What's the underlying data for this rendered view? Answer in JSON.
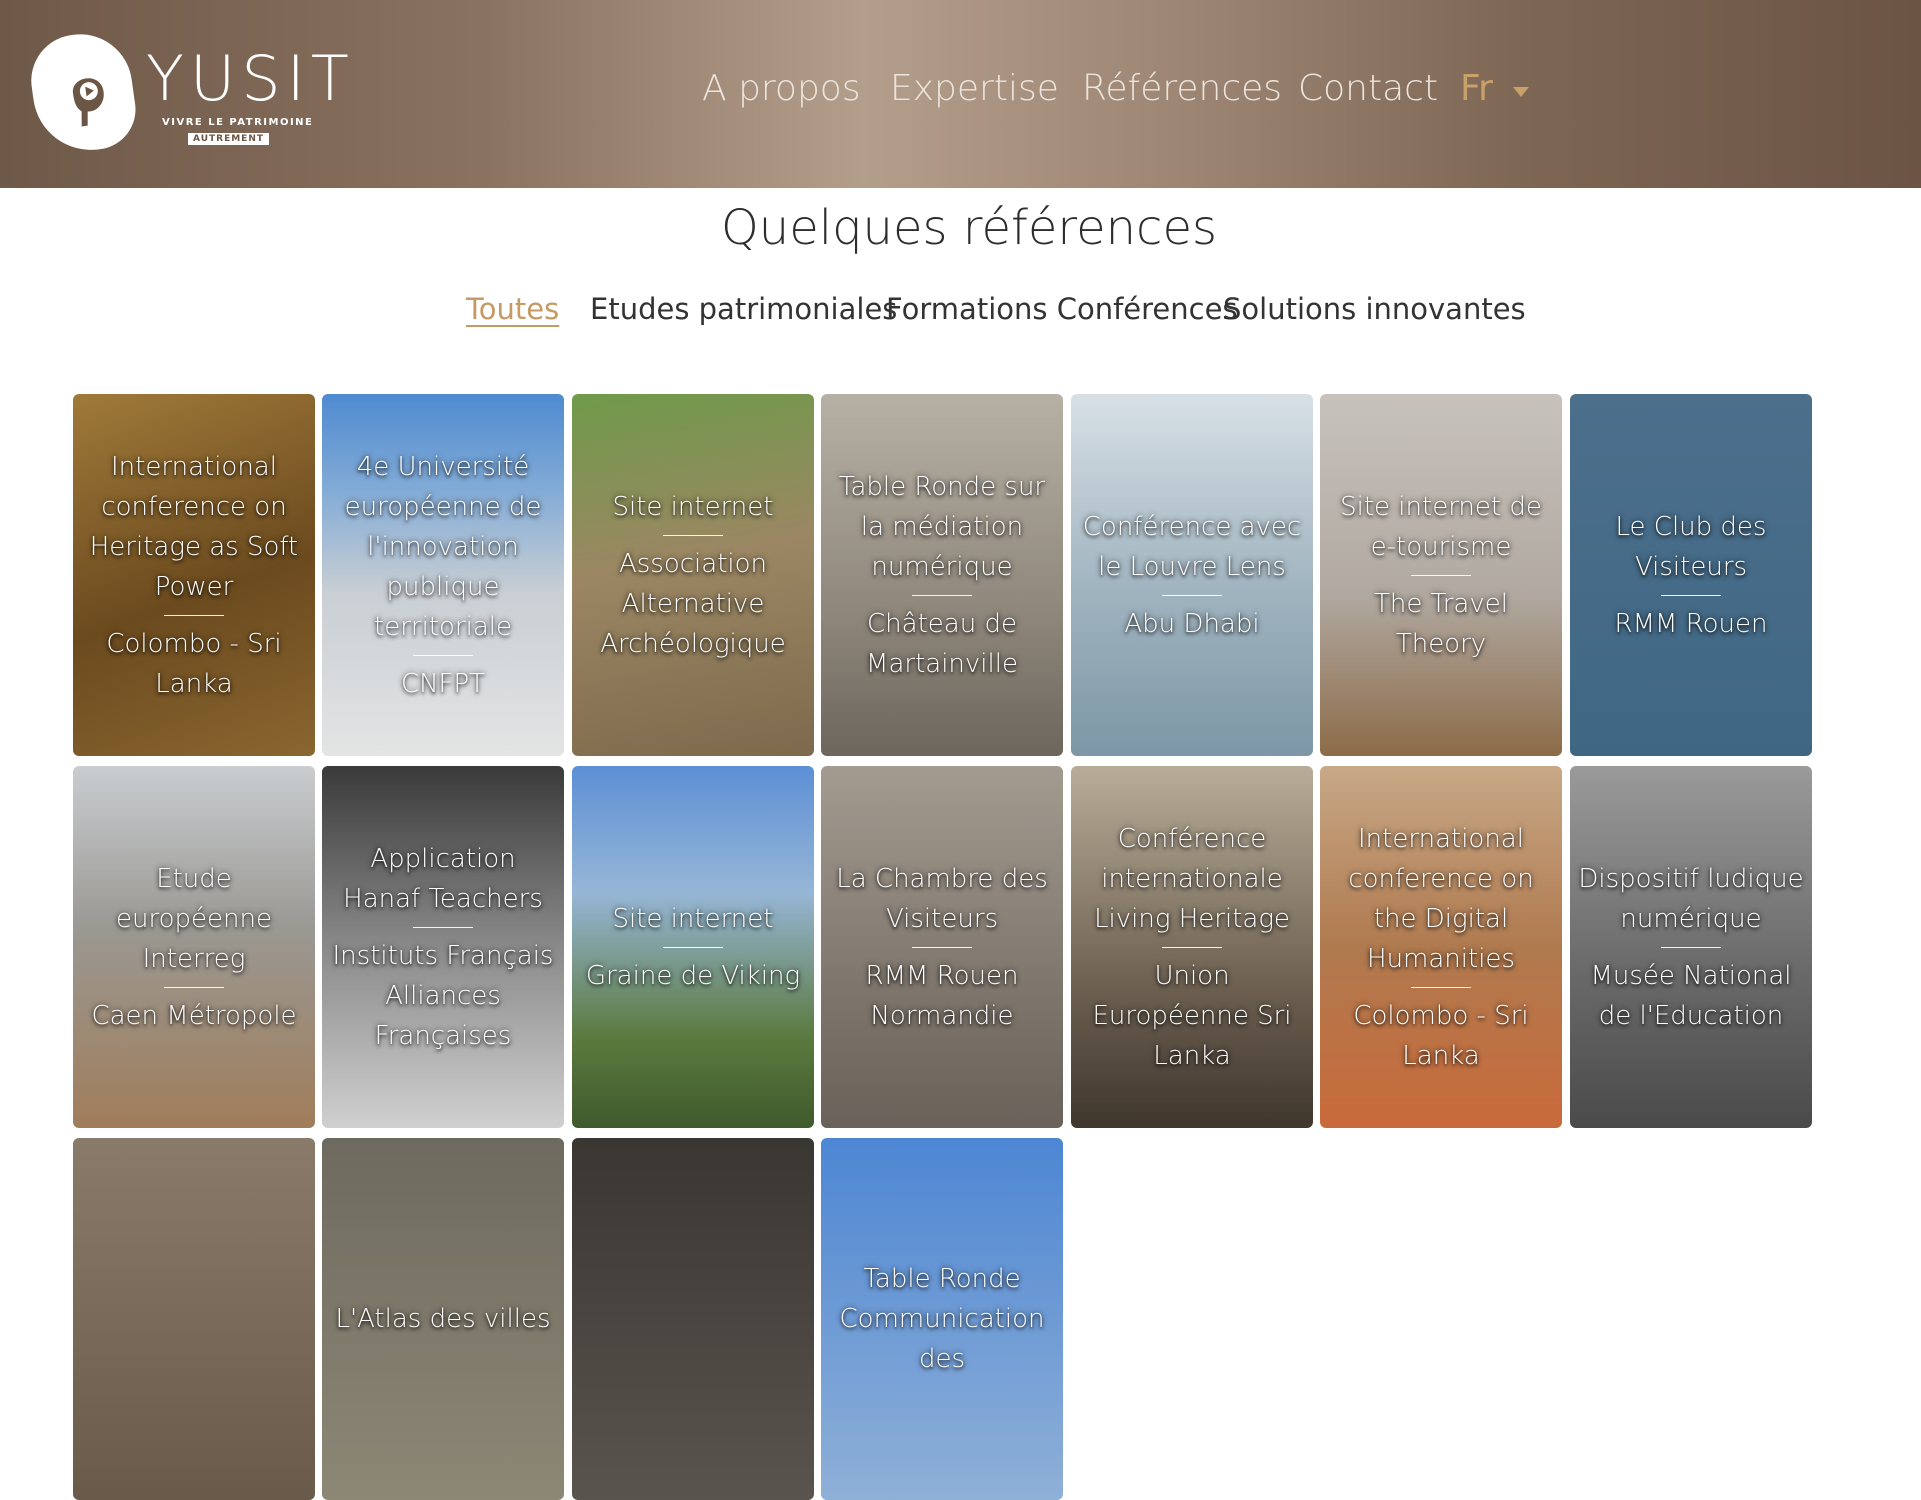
{
  "brand": {
    "name": "YUSIT",
    "tagline": "VIVRE LE PATRIMOINE",
    "tag": "AUTREMENT"
  },
  "nav": {
    "items": [
      "A propos",
      "Expertise",
      "Références",
      "Contact"
    ],
    "lang": "Fr"
  },
  "page": {
    "title": "Quelques références"
  },
  "filters": [
    "Toutes",
    "Etudes patrimoniales",
    "Formations Conférences",
    "Solutions innovantes"
  ],
  "cards": [
    {
      "title": "International conference on Heritage as Soft Power",
      "subtitle": "Colombo - Sri Lanka"
    },
    {
      "title": "4e Université européenne de l'innovation publique territoriale",
      "subtitle": "CNFPT"
    },
    {
      "title": "Site internet",
      "subtitle": "Association Alternative Archéologique"
    },
    {
      "title": "Table Ronde sur la médiation numérique",
      "subtitle": "Château de Martainville"
    },
    {
      "title": "Conférence avec le Louvre Lens",
      "subtitle": "Abu Dhabi"
    },
    {
      "title": "Site internet de e-tourisme",
      "subtitle": "The Travel Theory"
    },
    {
      "title": "Le Club des Visiteurs",
      "subtitle": "RMM Rouen"
    },
    {
      "title": "Etude européenne Interreg",
      "subtitle": "Caen Métropole"
    },
    {
      "title": "Application Hanaf Teachers",
      "subtitle": "Instituts Français Alliances Françaises"
    },
    {
      "title": "Site internet",
      "subtitle": "Graine de Viking"
    },
    {
      "title": "La Chambre des Visiteurs",
      "subtitle": "RMM Rouen Normandie"
    },
    {
      "title": "Conférence internationale Living Heritage",
      "subtitle": "Union Européenne Sri Lanka"
    },
    {
      "title": "International conference on the Digital Humanities",
      "subtitle": "Colombo - Sri Lanka"
    },
    {
      "title": "Dispositif ludique numérique",
      "subtitle": "Musée National de l'Education"
    },
    {
      "title": "",
      "subtitle": ""
    },
    {
      "title": "L'Atlas des villes",
      "subtitle": ""
    },
    {
      "title": "",
      "subtitle": ""
    },
    {
      "title": "Table Ronde Communication des",
      "subtitle": ""
    }
  ],
  "colors": {
    "accent": "#c59a63",
    "header_dark": "#6e5847",
    "header_light": "#b39d8b"
  }
}
